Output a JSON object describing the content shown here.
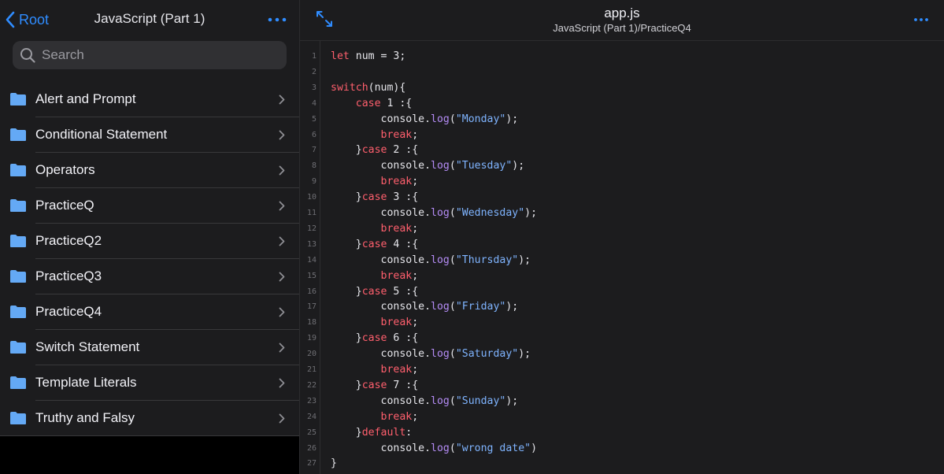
{
  "colors": {
    "accent": "#2f8cff",
    "keyword": "#ff5f6d",
    "string": "#7fb4ff",
    "method": "#b48cf5",
    "folder_icon": "#64a9f5",
    "chevron": "#8e8e93"
  },
  "sidebar": {
    "back_label": "Root",
    "title": "JavaScript (Part 1)",
    "more_icon": "ellipsis-icon",
    "search_placeholder": "Search",
    "search_icon": "magnifier-icon",
    "folders": [
      {
        "label": "Alert and Prompt"
      },
      {
        "label": "Conditional Statement"
      },
      {
        "label": "Operators"
      },
      {
        "label": "PracticeQ"
      },
      {
        "label": "PracticeQ2"
      },
      {
        "label": "PracticeQ3"
      },
      {
        "label": "PracticeQ4"
      },
      {
        "label": "Switch Statement"
      },
      {
        "label": "Template Literals"
      },
      {
        "label": "Truthy and Falsy"
      }
    ]
  },
  "editor": {
    "file_name": "app.js",
    "file_path": "JavaScript (Part 1)/PracticeQ4",
    "lines": [
      [
        [
          "keyword",
          "let"
        ],
        [
          "plain",
          " num = 3;"
        ]
      ],
      [],
      [
        [
          "keyword",
          "switch"
        ],
        [
          "plain",
          "(num){"
        ]
      ],
      [
        [
          "plain",
          "    "
        ],
        [
          "keyword",
          "case"
        ],
        [
          "plain",
          " 1 :{"
        ]
      ],
      [
        [
          "plain",
          "        console."
        ],
        [
          "method",
          "log"
        ],
        [
          "plain",
          "("
        ],
        [
          "string",
          "\"Monday\""
        ],
        [
          "plain",
          ");"
        ]
      ],
      [
        [
          "plain",
          "        "
        ],
        [
          "keyword",
          "break"
        ],
        [
          "plain",
          ";"
        ]
      ],
      [
        [
          "plain",
          "    }"
        ],
        [
          "keyword",
          "case"
        ],
        [
          "plain",
          " 2 :{"
        ]
      ],
      [
        [
          "plain",
          "        console."
        ],
        [
          "method",
          "log"
        ],
        [
          "plain",
          "("
        ],
        [
          "string",
          "\"Tuesday\""
        ],
        [
          "plain",
          ");"
        ]
      ],
      [
        [
          "plain",
          "        "
        ],
        [
          "keyword",
          "break"
        ],
        [
          "plain",
          ";"
        ]
      ],
      [
        [
          "plain",
          "    }"
        ],
        [
          "keyword",
          "case"
        ],
        [
          "plain",
          " 3 :{"
        ]
      ],
      [
        [
          "plain",
          "        console."
        ],
        [
          "method",
          "log"
        ],
        [
          "plain",
          "("
        ],
        [
          "string",
          "\"Wednesday\""
        ],
        [
          "plain",
          ");"
        ]
      ],
      [
        [
          "plain",
          "        "
        ],
        [
          "keyword",
          "break"
        ],
        [
          "plain",
          ";"
        ]
      ],
      [
        [
          "plain",
          "    }"
        ],
        [
          "keyword",
          "case"
        ],
        [
          "plain",
          " 4 :{"
        ]
      ],
      [
        [
          "plain",
          "        console."
        ],
        [
          "method",
          "log"
        ],
        [
          "plain",
          "("
        ],
        [
          "string",
          "\"Thursday\""
        ],
        [
          "plain",
          ");"
        ]
      ],
      [
        [
          "plain",
          "        "
        ],
        [
          "keyword",
          "break"
        ],
        [
          "plain",
          ";"
        ]
      ],
      [
        [
          "plain",
          "    }"
        ],
        [
          "keyword",
          "case"
        ],
        [
          "plain",
          " 5 :{"
        ]
      ],
      [
        [
          "plain",
          "        console."
        ],
        [
          "method",
          "log"
        ],
        [
          "plain",
          "("
        ],
        [
          "string",
          "\"Friday\""
        ],
        [
          "plain",
          ");"
        ]
      ],
      [
        [
          "plain",
          "        "
        ],
        [
          "keyword",
          "break"
        ],
        [
          "plain",
          ";"
        ]
      ],
      [
        [
          "plain",
          "    }"
        ],
        [
          "keyword",
          "case"
        ],
        [
          "plain",
          " 6 :{"
        ]
      ],
      [
        [
          "plain",
          "        console."
        ],
        [
          "method",
          "log"
        ],
        [
          "plain",
          "("
        ],
        [
          "string",
          "\"Saturday\""
        ],
        [
          "plain",
          ");"
        ]
      ],
      [
        [
          "plain",
          "        "
        ],
        [
          "keyword",
          "break"
        ],
        [
          "plain",
          ";"
        ]
      ],
      [
        [
          "plain",
          "    }"
        ],
        [
          "keyword",
          "case"
        ],
        [
          "plain",
          " 7 :{"
        ]
      ],
      [
        [
          "plain",
          "        console."
        ],
        [
          "method",
          "log"
        ],
        [
          "plain",
          "("
        ],
        [
          "string",
          "\"Sunday\""
        ],
        [
          "plain",
          ");"
        ]
      ],
      [
        [
          "plain",
          "        "
        ],
        [
          "keyword",
          "break"
        ],
        [
          "plain",
          ";"
        ]
      ],
      [
        [
          "plain",
          "    }"
        ],
        [
          "keyword",
          "default"
        ],
        [
          "plain",
          ":"
        ]
      ],
      [
        [
          "plain",
          "        console."
        ],
        [
          "method",
          "log"
        ],
        [
          "plain",
          "("
        ],
        [
          "string",
          "\"wrong date\""
        ],
        [
          "plain",
          ")"
        ]
      ],
      [
        [
          "plain",
          "}"
        ]
      ]
    ]
  }
}
